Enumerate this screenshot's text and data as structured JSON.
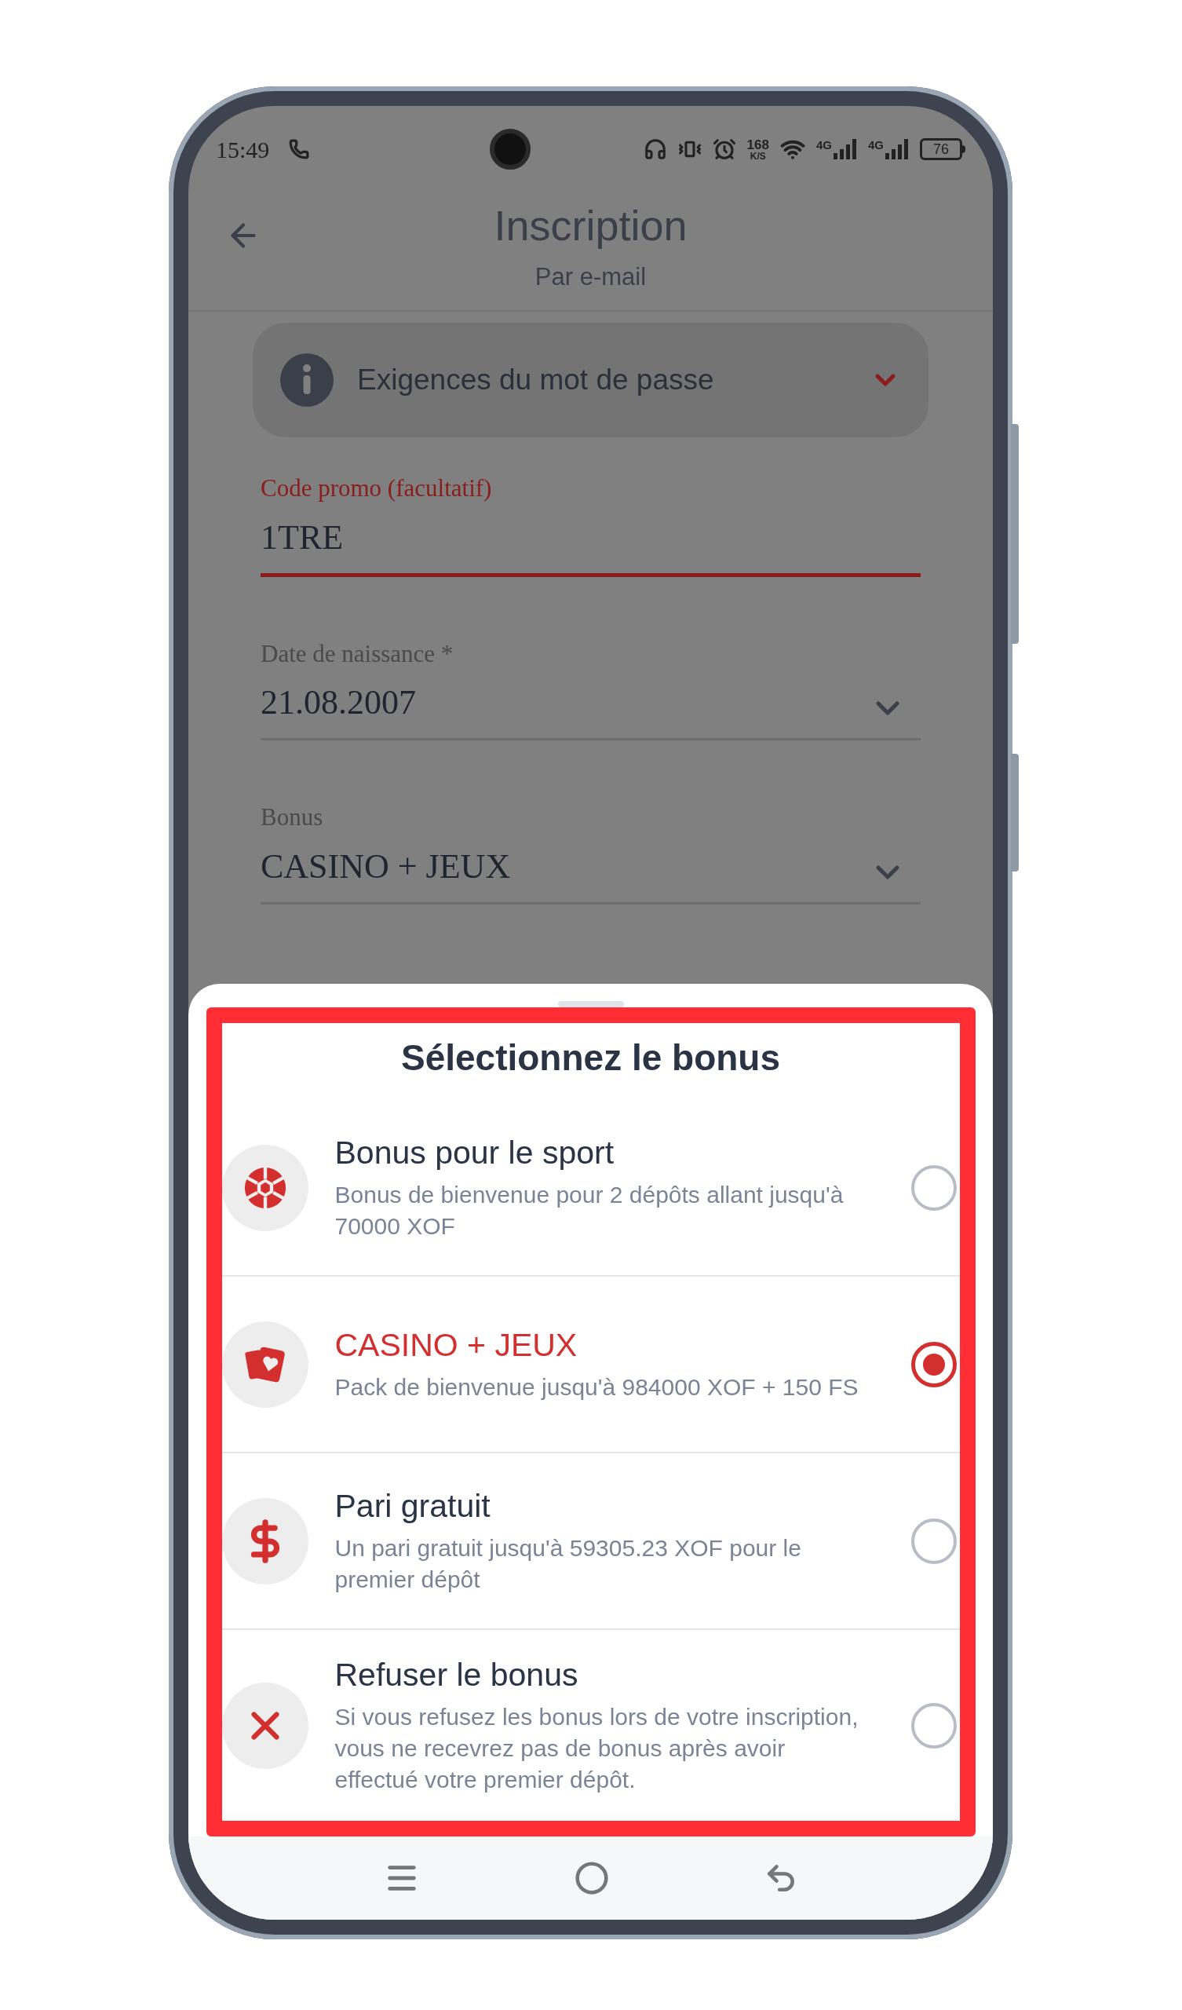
{
  "status_bar": {
    "time": "15:49",
    "speed": "168",
    "speed_unit": "K/S",
    "networks": [
      "4G",
      "4G"
    ],
    "battery": "76"
  },
  "header": {
    "title": "Inscription",
    "subtitle": "Par e-mail"
  },
  "info_panel": {
    "label": "Exigences du mot de passe",
    "expanded": false
  },
  "fields": [
    {
      "kind": "text",
      "label": "Code promo (facultatif)",
      "value": "1TRE",
      "focused": true
    },
    {
      "kind": "select",
      "label": "Date de naissance *",
      "value": "21.08.2007",
      "focused": false
    },
    {
      "kind": "select",
      "label": "Bonus",
      "value": "CASINO + JEUX",
      "focused": false
    }
  ],
  "sheet": {
    "title": "Sélectionnez le bonus",
    "options": [
      {
        "kind": "sport",
        "title": "Bonus pour le sport",
        "description": "Bonus de bienvenue pour 2 dépôts allant jusqu'à 70000 XOF",
        "selected": false
      },
      {
        "kind": "casino",
        "title": "CASINO + JEUX",
        "description": "Pack de bienvenue jusqu'à 984000 XOF + 150 FS",
        "selected": true
      },
      {
        "kind": "freebet",
        "title": "Pari gratuit",
        "description": "Un pari gratuit jusqu'à 59305.23 XOF pour le premier dépôt",
        "selected": false
      },
      {
        "kind": "refuse",
        "title": "Refuser le bonus",
        "description": "Si vous refusez les bonus lors de votre inscription, vous ne recevrez pas de bonus après avoir effectué votre premier dépôt.",
        "selected": false
      }
    ]
  }
}
